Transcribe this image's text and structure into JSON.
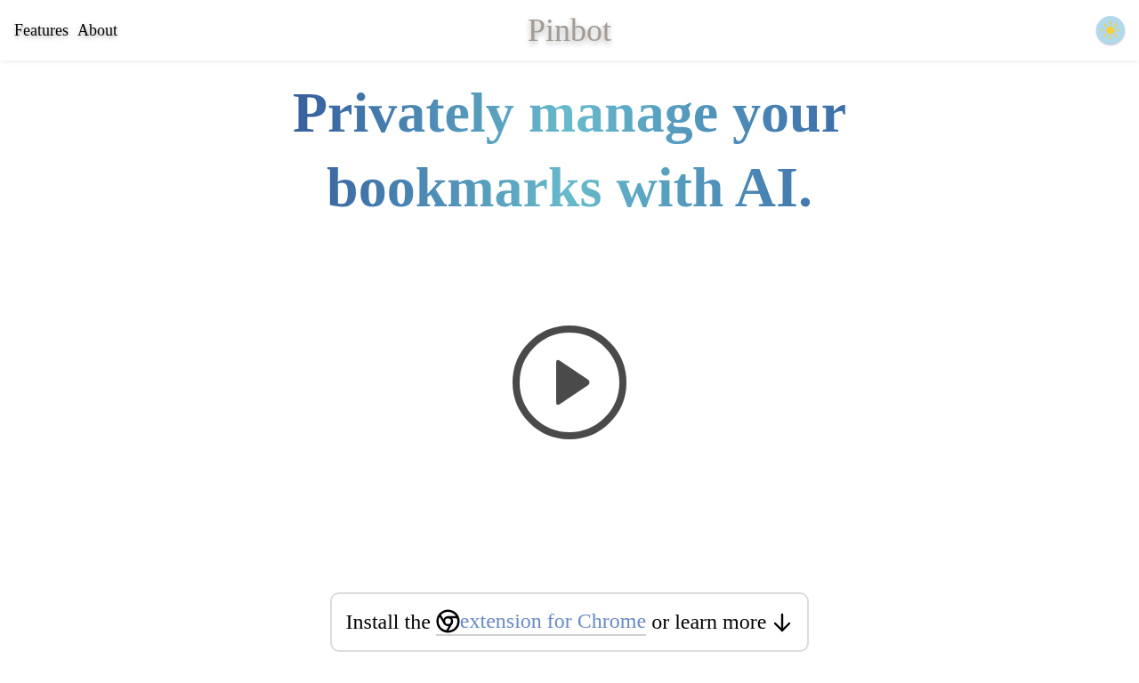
{
  "header": {
    "nav_links": [
      "Features",
      "About"
    ],
    "logo": "Pinbot"
  },
  "hero": {
    "headline": "Privately manage your bookmarks with AI."
  },
  "install_bar": {
    "before_link": "Install the",
    "link": "extension for Chrome",
    "after_link": "or learn more"
  }
}
